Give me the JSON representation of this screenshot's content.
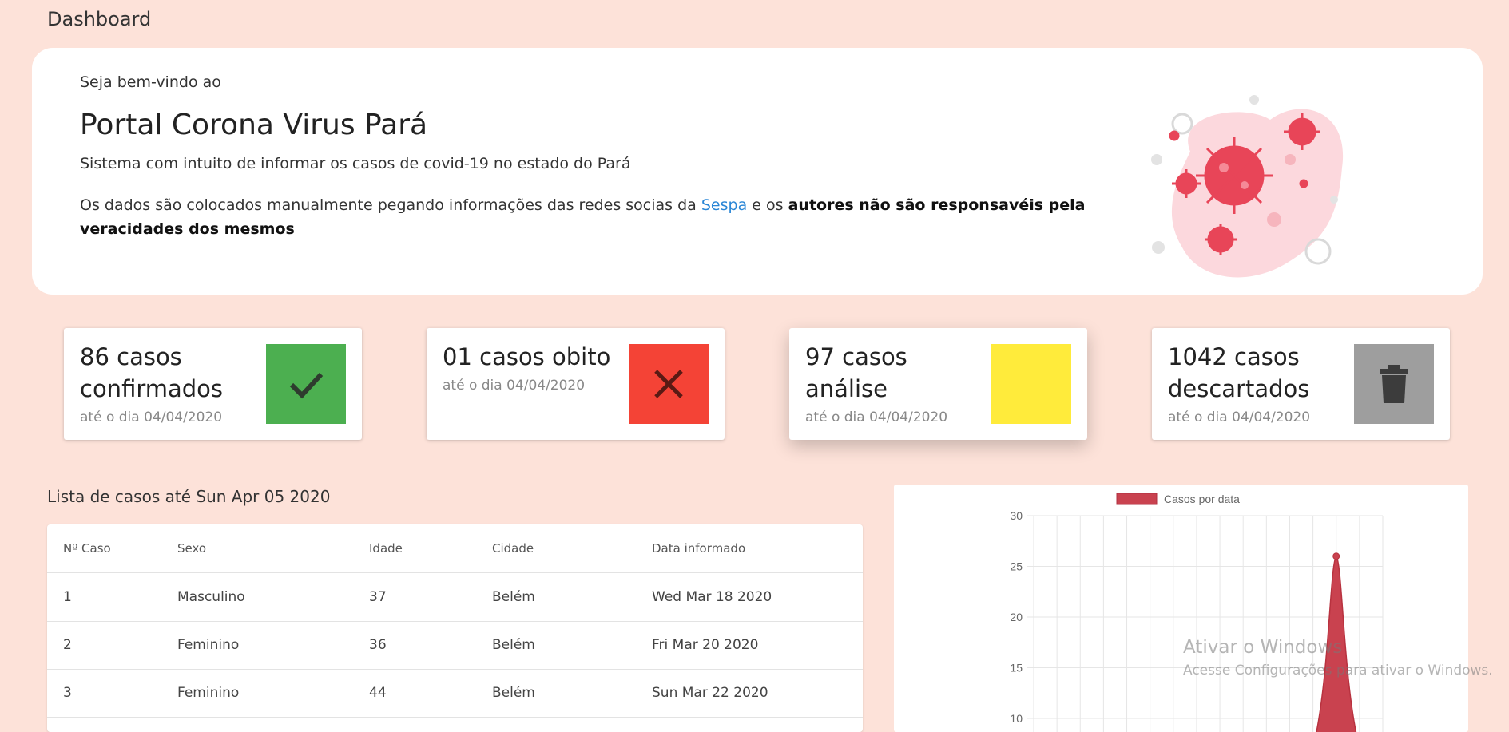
{
  "page": {
    "title": "Dashboard"
  },
  "welcome": {
    "greeting": "Seja bem-vindo ao",
    "title": "Portal Corona Virus Pará",
    "subtitle": "Sistema com intuito de informar os casos de covid-19 no estado do Pará",
    "notice_prefix": "Os dados são colocados manualmente pegando informações das redes socias da",
    "notice_link": "Sespa",
    "notice_middle": "e os",
    "notice_bold": "autores não são responsavéis pela veracidades dos mesmos",
    "illustration_icon": "virus-illustration"
  },
  "stats": [
    {
      "title": "86 casos confirmados",
      "date": "até o dia 04/04/2020",
      "color": "#4caf50",
      "icon": "check-icon"
    },
    {
      "title": "01 casos obito",
      "date": "até o dia 04/04/2020",
      "color": "#f44336",
      "icon": "close-icon"
    },
    {
      "title": "97 casos análise",
      "date": "até o dia 04/04/2020",
      "color": "#ffeb3b",
      "icon": ""
    },
    {
      "title": "1042 casos descartados",
      "date": "até o dia 04/04/2020",
      "color": "#9e9e9e",
      "icon": "trash-icon"
    }
  ],
  "cases": {
    "title": "Lista de casos até Sun Apr 05 2020",
    "columns": [
      "Nº Caso",
      "Sexo",
      "Idade",
      "Cidade",
      "Data informado"
    ],
    "rows": [
      [
        "1",
        "Masculino",
        "37",
        "Belém",
        "Wed Mar 18 2020"
      ],
      [
        "2",
        "Feminino",
        "36",
        "Belém",
        "Fri Mar 20 2020"
      ],
      [
        "3",
        "Feminino",
        "44",
        "Belém",
        "Sun Mar 22 2020"
      ]
    ]
  },
  "chart_data": {
    "type": "area",
    "legend": "Casos por data",
    "legend_position": "top",
    "series_color": "#c9424f",
    "y_ticks": [
      30,
      25,
      20,
      15,
      10
    ],
    "ylim_visible": [
      10,
      30
    ],
    "grid": true,
    "x_count": 16,
    "values_visible": [
      {
        "index": 13,
        "value": 26
      }
    ]
  },
  "watermark": {
    "title": "Ativar o Windows",
    "subtitle": "Acesse Configurações para ativar o Windows."
  }
}
